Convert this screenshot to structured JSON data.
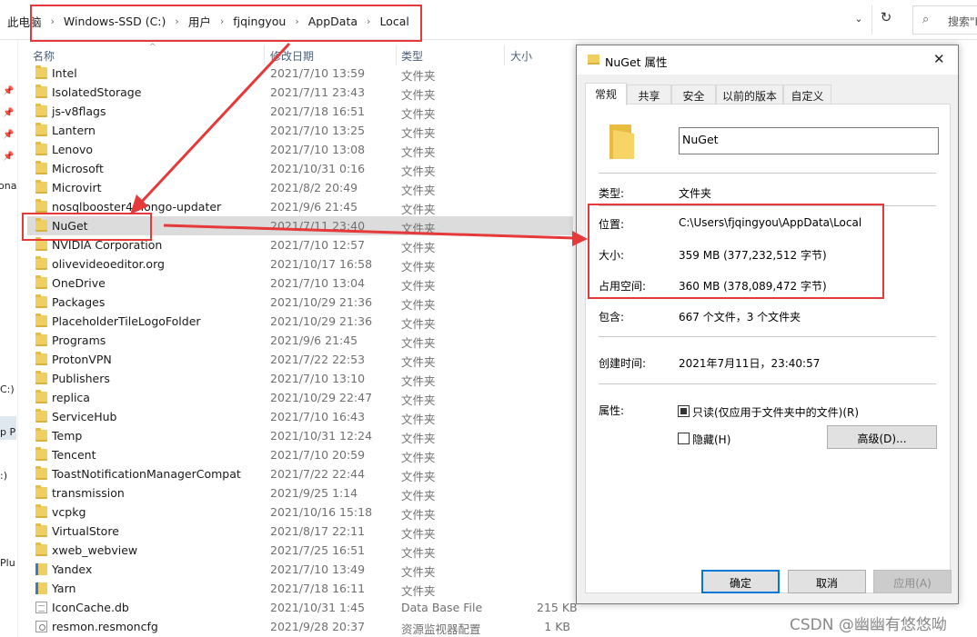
{
  "address_bar": {
    "crumbs": [
      "此电脑",
      "Windows-SSD (C:)",
      "用户",
      "fjqingyou",
      "AppData",
      "Local"
    ],
    "search_placeholder": "搜索\"L"
  },
  "nav": {
    "fragments": [
      "ona",
      "C:)",
      "p P",
      ":)",
      "Plu"
    ]
  },
  "columns": {
    "name": "名称",
    "date": "修改日期",
    "type": "类型",
    "size": "大小"
  },
  "files": [
    {
      "name": "Intel",
      "date": "2021/7/10 13:59",
      "type": "文件夹",
      "size": "",
      "icon": "folder-icon"
    },
    {
      "name": "IsolatedStorage",
      "date": "2021/7/11 23:43",
      "type": "文件夹",
      "size": "",
      "icon": "folder-icon"
    },
    {
      "name": "js-v8flags",
      "date": "2021/7/18 16:51",
      "type": "文件夹",
      "size": "",
      "icon": "folder-icon"
    },
    {
      "name": "Lantern",
      "date": "2021/7/10 13:25",
      "type": "文件夹",
      "size": "",
      "icon": "folder-icon"
    },
    {
      "name": "Lenovo",
      "date": "2021/7/10 13:08",
      "type": "文件夹",
      "size": "",
      "icon": "folder-icon"
    },
    {
      "name": "Microsoft",
      "date": "2021/10/31 0:16",
      "type": "文件夹",
      "size": "",
      "icon": "folder-icon"
    },
    {
      "name": "Microvirt",
      "date": "2021/8/2 20:49",
      "type": "文件夹",
      "size": "",
      "icon": "folder-icon"
    },
    {
      "name": "nosqlbooster4mongo-updater",
      "date": "2021/9/6 21:45",
      "type": "文件夹",
      "size": "",
      "icon": "folder-icon"
    },
    {
      "name": "NuGet",
      "date": "2021/7/11 23:40",
      "type": "文件夹",
      "size": "",
      "icon": "folder-icon"
    },
    {
      "name": "NVIDIA Corporation",
      "date": "2021/7/10 12:57",
      "type": "文件夹",
      "size": "",
      "icon": "folder-icon"
    },
    {
      "name": "olivevideoeditor.org",
      "date": "2021/10/17 16:58",
      "type": "文件夹",
      "size": "",
      "icon": "folder-icon"
    },
    {
      "name": "OneDrive",
      "date": "2021/7/10 13:04",
      "type": "文件夹",
      "size": "",
      "icon": "folder-icon"
    },
    {
      "name": "Packages",
      "date": "2021/10/29 21:36",
      "type": "文件夹",
      "size": "",
      "icon": "folder-icon"
    },
    {
      "name": "PlaceholderTileLogoFolder",
      "date": "2021/10/29 21:36",
      "type": "文件夹",
      "size": "",
      "icon": "folder-icon"
    },
    {
      "name": "Programs",
      "date": "2021/9/6 21:45",
      "type": "文件夹",
      "size": "",
      "icon": "folder-icon"
    },
    {
      "name": "ProtonVPN",
      "date": "2021/7/22 22:53",
      "type": "文件夹",
      "size": "",
      "icon": "folder-icon"
    },
    {
      "name": "Publishers",
      "date": "2021/7/10 13:10",
      "type": "文件夹",
      "size": "",
      "icon": "folder-icon"
    },
    {
      "name": "replica",
      "date": "2021/10/29 22:47",
      "type": "文件夹",
      "size": "",
      "icon": "folder-icon"
    },
    {
      "name": "ServiceHub",
      "date": "2021/7/10 16:43",
      "type": "文件夹",
      "size": "",
      "icon": "folder-icon"
    },
    {
      "name": "Temp",
      "date": "2021/10/31 12:24",
      "type": "文件夹",
      "size": "",
      "icon": "folder-icon"
    },
    {
      "name": "Tencent",
      "date": "2021/7/10 20:59",
      "type": "文件夹",
      "size": "",
      "icon": "folder-icon"
    },
    {
      "name": "ToastNotificationManagerCompat",
      "date": "2021/7/22 22:44",
      "type": "文件夹",
      "size": "",
      "icon": "folder-icon"
    },
    {
      "name": "transmission",
      "date": "2021/9/25 1:14",
      "type": "文件夹",
      "size": "",
      "icon": "folder-icon"
    },
    {
      "name": "vcpkg",
      "date": "2021/10/16 15:18",
      "type": "文件夹",
      "size": "",
      "icon": "folder-icon"
    },
    {
      "name": "VirtualStore",
      "date": "2021/8/17 22:11",
      "type": "文件夹",
      "size": "",
      "icon": "folder-icon"
    },
    {
      "name": "xweb_webview",
      "date": "2021/7/25 16:51",
      "type": "文件夹",
      "size": "",
      "icon": "folder-icon"
    },
    {
      "name": "Yandex",
      "date": "2021/7/10 13:49",
      "type": "文件夹",
      "size": "",
      "icon": "virtual-folder-icon"
    },
    {
      "name": "Yarn",
      "date": "2021/7/18 16:11",
      "type": "文件夹",
      "size": "",
      "icon": "virtual-folder-icon"
    },
    {
      "name": "IconCache.db",
      "date": "2021/10/31 1:45",
      "type": "Data Base File",
      "size": "215 KB",
      "icon": "database-file-icon"
    },
    {
      "name": "resmon.resmoncfg",
      "date": "2021/9/28 20:37",
      "type": "资源监视器配置",
      "size": "1 KB",
      "icon": "config-file-icon"
    }
  ],
  "selected_index": 8,
  "dialog": {
    "title": "NuGet 属性",
    "close_glyph": "✕",
    "tabs": [
      "常规",
      "共享",
      "安全",
      "以前的版本",
      "自定义"
    ],
    "active_tab": 0,
    "folder_name": "NuGet",
    "type_label": "类型:",
    "type_value": "文件夹",
    "location_label": "位置:",
    "location_value": "C:\\Users\\fjqingyou\\AppData\\Local",
    "size_label": "大小:",
    "size_value": "359 MB (377,232,512 字节)",
    "disk_size_label": "占用空间:",
    "disk_size_value": "360 MB (378,089,472 字节)",
    "contains_label": "包含:",
    "contains_value": "667 个文件，3 个文件夹",
    "created_label": "创建时间:",
    "created_value": "2021年7月11日，23:40:57",
    "attributes_label": "属性:",
    "readonly_label": "只读(仅应用于文件夹中的文件)(R)",
    "readonly_checked": true,
    "hidden_label": "隐藏(H)",
    "hidden_checked": false,
    "advanced_button": "高级(D)...",
    "ok_button": "确定",
    "cancel_button": "取消",
    "apply_button": "应用(A)"
  },
  "watermark": "CSDN @幽幽有悠悠呦",
  "colors": {
    "highlight": "#e5393a",
    "selected_row": "#dcdcdc",
    "focus_blue": "#0078d7",
    "folder": "#f0cf62"
  }
}
